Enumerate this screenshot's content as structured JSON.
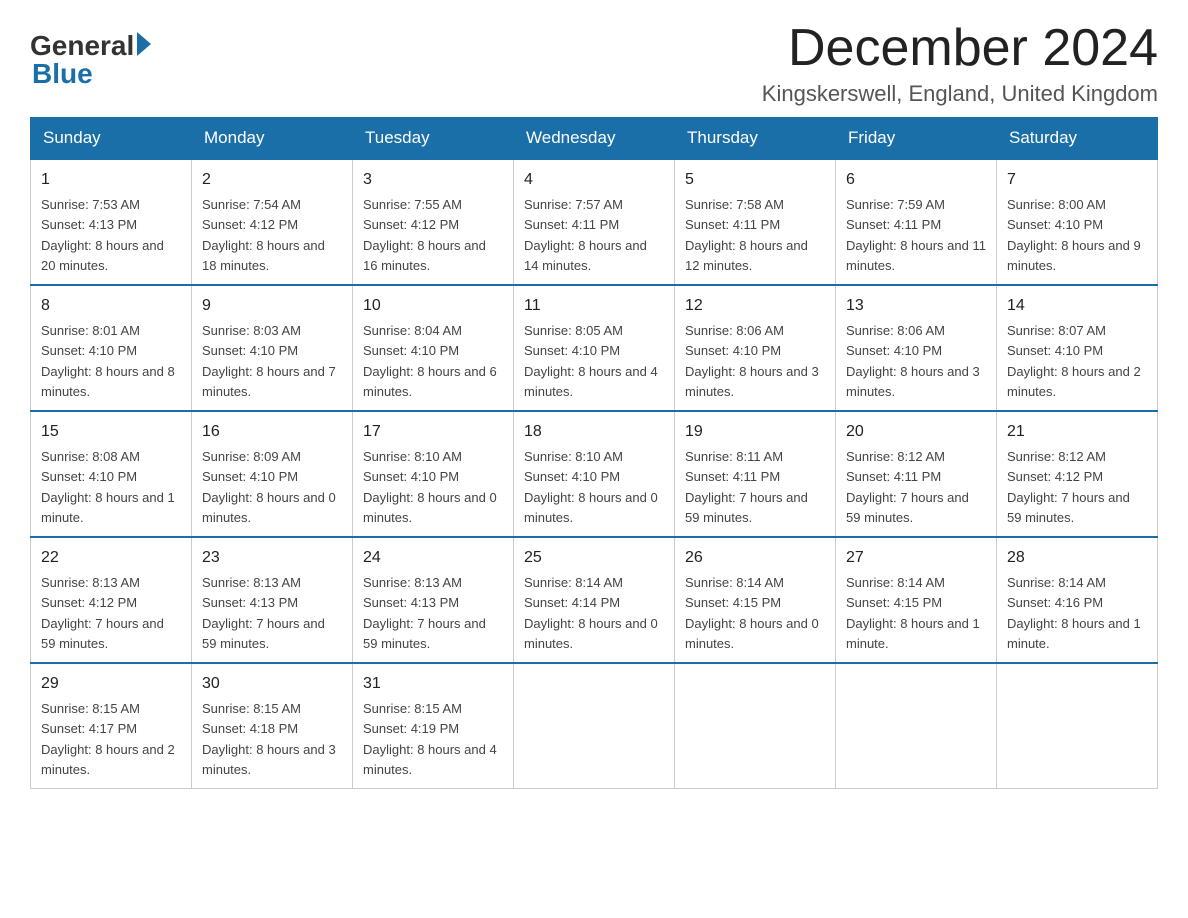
{
  "header": {
    "logo_general": "General",
    "logo_blue": "Blue",
    "month_title": "December 2024",
    "location": "Kingskerswell, England, United Kingdom"
  },
  "days_of_week": [
    "Sunday",
    "Monday",
    "Tuesday",
    "Wednesday",
    "Thursday",
    "Friday",
    "Saturday"
  ],
  "weeks": [
    [
      {
        "day": "1",
        "sunrise": "7:53 AM",
        "sunset": "4:13 PM",
        "daylight": "8 hours and 20 minutes."
      },
      {
        "day": "2",
        "sunrise": "7:54 AM",
        "sunset": "4:12 PM",
        "daylight": "8 hours and 18 minutes."
      },
      {
        "day": "3",
        "sunrise": "7:55 AM",
        "sunset": "4:12 PM",
        "daylight": "8 hours and 16 minutes."
      },
      {
        "day": "4",
        "sunrise": "7:57 AM",
        "sunset": "4:11 PM",
        "daylight": "8 hours and 14 minutes."
      },
      {
        "day": "5",
        "sunrise": "7:58 AM",
        "sunset": "4:11 PM",
        "daylight": "8 hours and 12 minutes."
      },
      {
        "day": "6",
        "sunrise": "7:59 AM",
        "sunset": "4:11 PM",
        "daylight": "8 hours and 11 minutes."
      },
      {
        "day": "7",
        "sunrise": "8:00 AM",
        "sunset": "4:10 PM",
        "daylight": "8 hours and 9 minutes."
      }
    ],
    [
      {
        "day": "8",
        "sunrise": "8:01 AM",
        "sunset": "4:10 PM",
        "daylight": "8 hours and 8 minutes."
      },
      {
        "day": "9",
        "sunrise": "8:03 AM",
        "sunset": "4:10 PM",
        "daylight": "8 hours and 7 minutes."
      },
      {
        "day": "10",
        "sunrise": "8:04 AM",
        "sunset": "4:10 PM",
        "daylight": "8 hours and 6 minutes."
      },
      {
        "day": "11",
        "sunrise": "8:05 AM",
        "sunset": "4:10 PM",
        "daylight": "8 hours and 4 minutes."
      },
      {
        "day": "12",
        "sunrise": "8:06 AM",
        "sunset": "4:10 PM",
        "daylight": "8 hours and 3 minutes."
      },
      {
        "day": "13",
        "sunrise": "8:06 AM",
        "sunset": "4:10 PM",
        "daylight": "8 hours and 3 minutes."
      },
      {
        "day": "14",
        "sunrise": "8:07 AM",
        "sunset": "4:10 PM",
        "daylight": "8 hours and 2 minutes."
      }
    ],
    [
      {
        "day": "15",
        "sunrise": "8:08 AM",
        "sunset": "4:10 PM",
        "daylight": "8 hours and 1 minute."
      },
      {
        "day": "16",
        "sunrise": "8:09 AM",
        "sunset": "4:10 PM",
        "daylight": "8 hours and 0 minutes."
      },
      {
        "day": "17",
        "sunrise": "8:10 AM",
        "sunset": "4:10 PM",
        "daylight": "8 hours and 0 minutes."
      },
      {
        "day": "18",
        "sunrise": "8:10 AM",
        "sunset": "4:10 PM",
        "daylight": "8 hours and 0 minutes."
      },
      {
        "day": "19",
        "sunrise": "8:11 AM",
        "sunset": "4:11 PM",
        "daylight": "7 hours and 59 minutes."
      },
      {
        "day": "20",
        "sunrise": "8:12 AM",
        "sunset": "4:11 PM",
        "daylight": "7 hours and 59 minutes."
      },
      {
        "day": "21",
        "sunrise": "8:12 AM",
        "sunset": "4:12 PM",
        "daylight": "7 hours and 59 minutes."
      }
    ],
    [
      {
        "day": "22",
        "sunrise": "8:13 AM",
        "sunset": "4:12 PM",
        "daylight": "7 hours and 59 minutes."
      },
      {
        "day": "23",
        "sunrise": "8:13 AM",
        "sunset": "4:13 PM",
        "daylight": "7 hours and 59 minutes."
      },
      {
        "day": "24",
        "sunrise": "8:13 AM",
        "sunset": "4:13 PM",
        "daylight": "7 hours and 59 minutes."
      },
      {
        "day": "25",
        "sunrise": "8:14 AM",
        "sunset": "4:14 PM",
        "daylight": "8 hours and 0 minutes."
      },
      {
        "day": "26",
        "sunrise": "8:14 AM",
        "sunset": "4:15 PM",
        "daylight": "8 hours and 0 minutes."
      },
      {
        "day": "27",
        "sunrise": "8:14 AM",
        "sunset": "4:15 PM",
        "daylight": "8 hours and 1 minute."
      },
      {
        "day": "28",
        "sunrise": "8:14 AM",
        "sunset": "4:16 PM",
        "daylight": "8 hours and 1 minute."
      }
    ],
    [
      {
        "day": "29",
        "sunrise": "8:15 AM",
        "sunset": "4:17 PM",
        "daylight": "8 hours and 2 minutes."
      },
      {
        "day": "30",
        "sunrise": "8:15 AM",
        "sunset": "4:18 PM",
        "daylight": "8 hours and 3 minutes."
      },
      {
        "day": "31",
        "sunrise": "8:15 AM",
        "sunset": "4:19 PM",
        "daylight": "8 hours and 4 minutes."
      },
      null,
      null,
      null,
      null
    ]
  ]
}
